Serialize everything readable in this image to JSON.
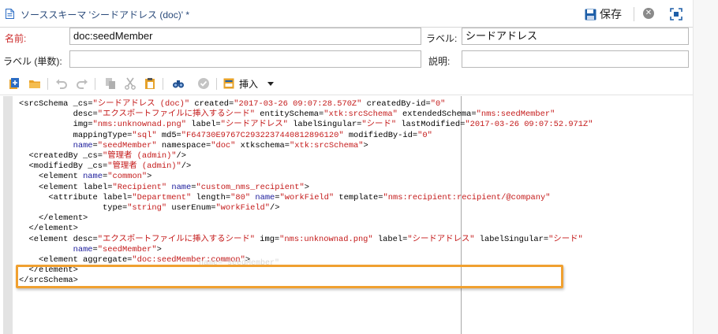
{
  "window": {
    "title": "ソーススキーマ 'シードアドレス (doc)' *",
    "save_label": "保存"
  },
  "form": {
    "name_label": "名前:",
    "name_value": "doc:seedMember",
    "label_label": "ラベル:",
    "label_value": "シードアドレス",
    "plural_label": "ラベル (単数):",
    "plural_value": "",
    "description_label": "説明:",
    "description_value": ""
  },
  "toolbar": {
    "insert_label": "挿入",
    "icons": [
      "add-icon",
      "open-folder-icon",
      "undo-icon",
      "redo-icon",
      "copy-icon",
      "cut-icon",
      "paste-icon",
      "find-icon",
      "validate-icon",
      "insert-icon"
    ]
  },
  "editor": {
    "ghost_text": "name=\"seedMember\""
  },
  "colors": {
    "highlight": "#f0a030",
    "attr_value": "#c41a1a",
    "required_label": "#cc2b2b"
  }
}
